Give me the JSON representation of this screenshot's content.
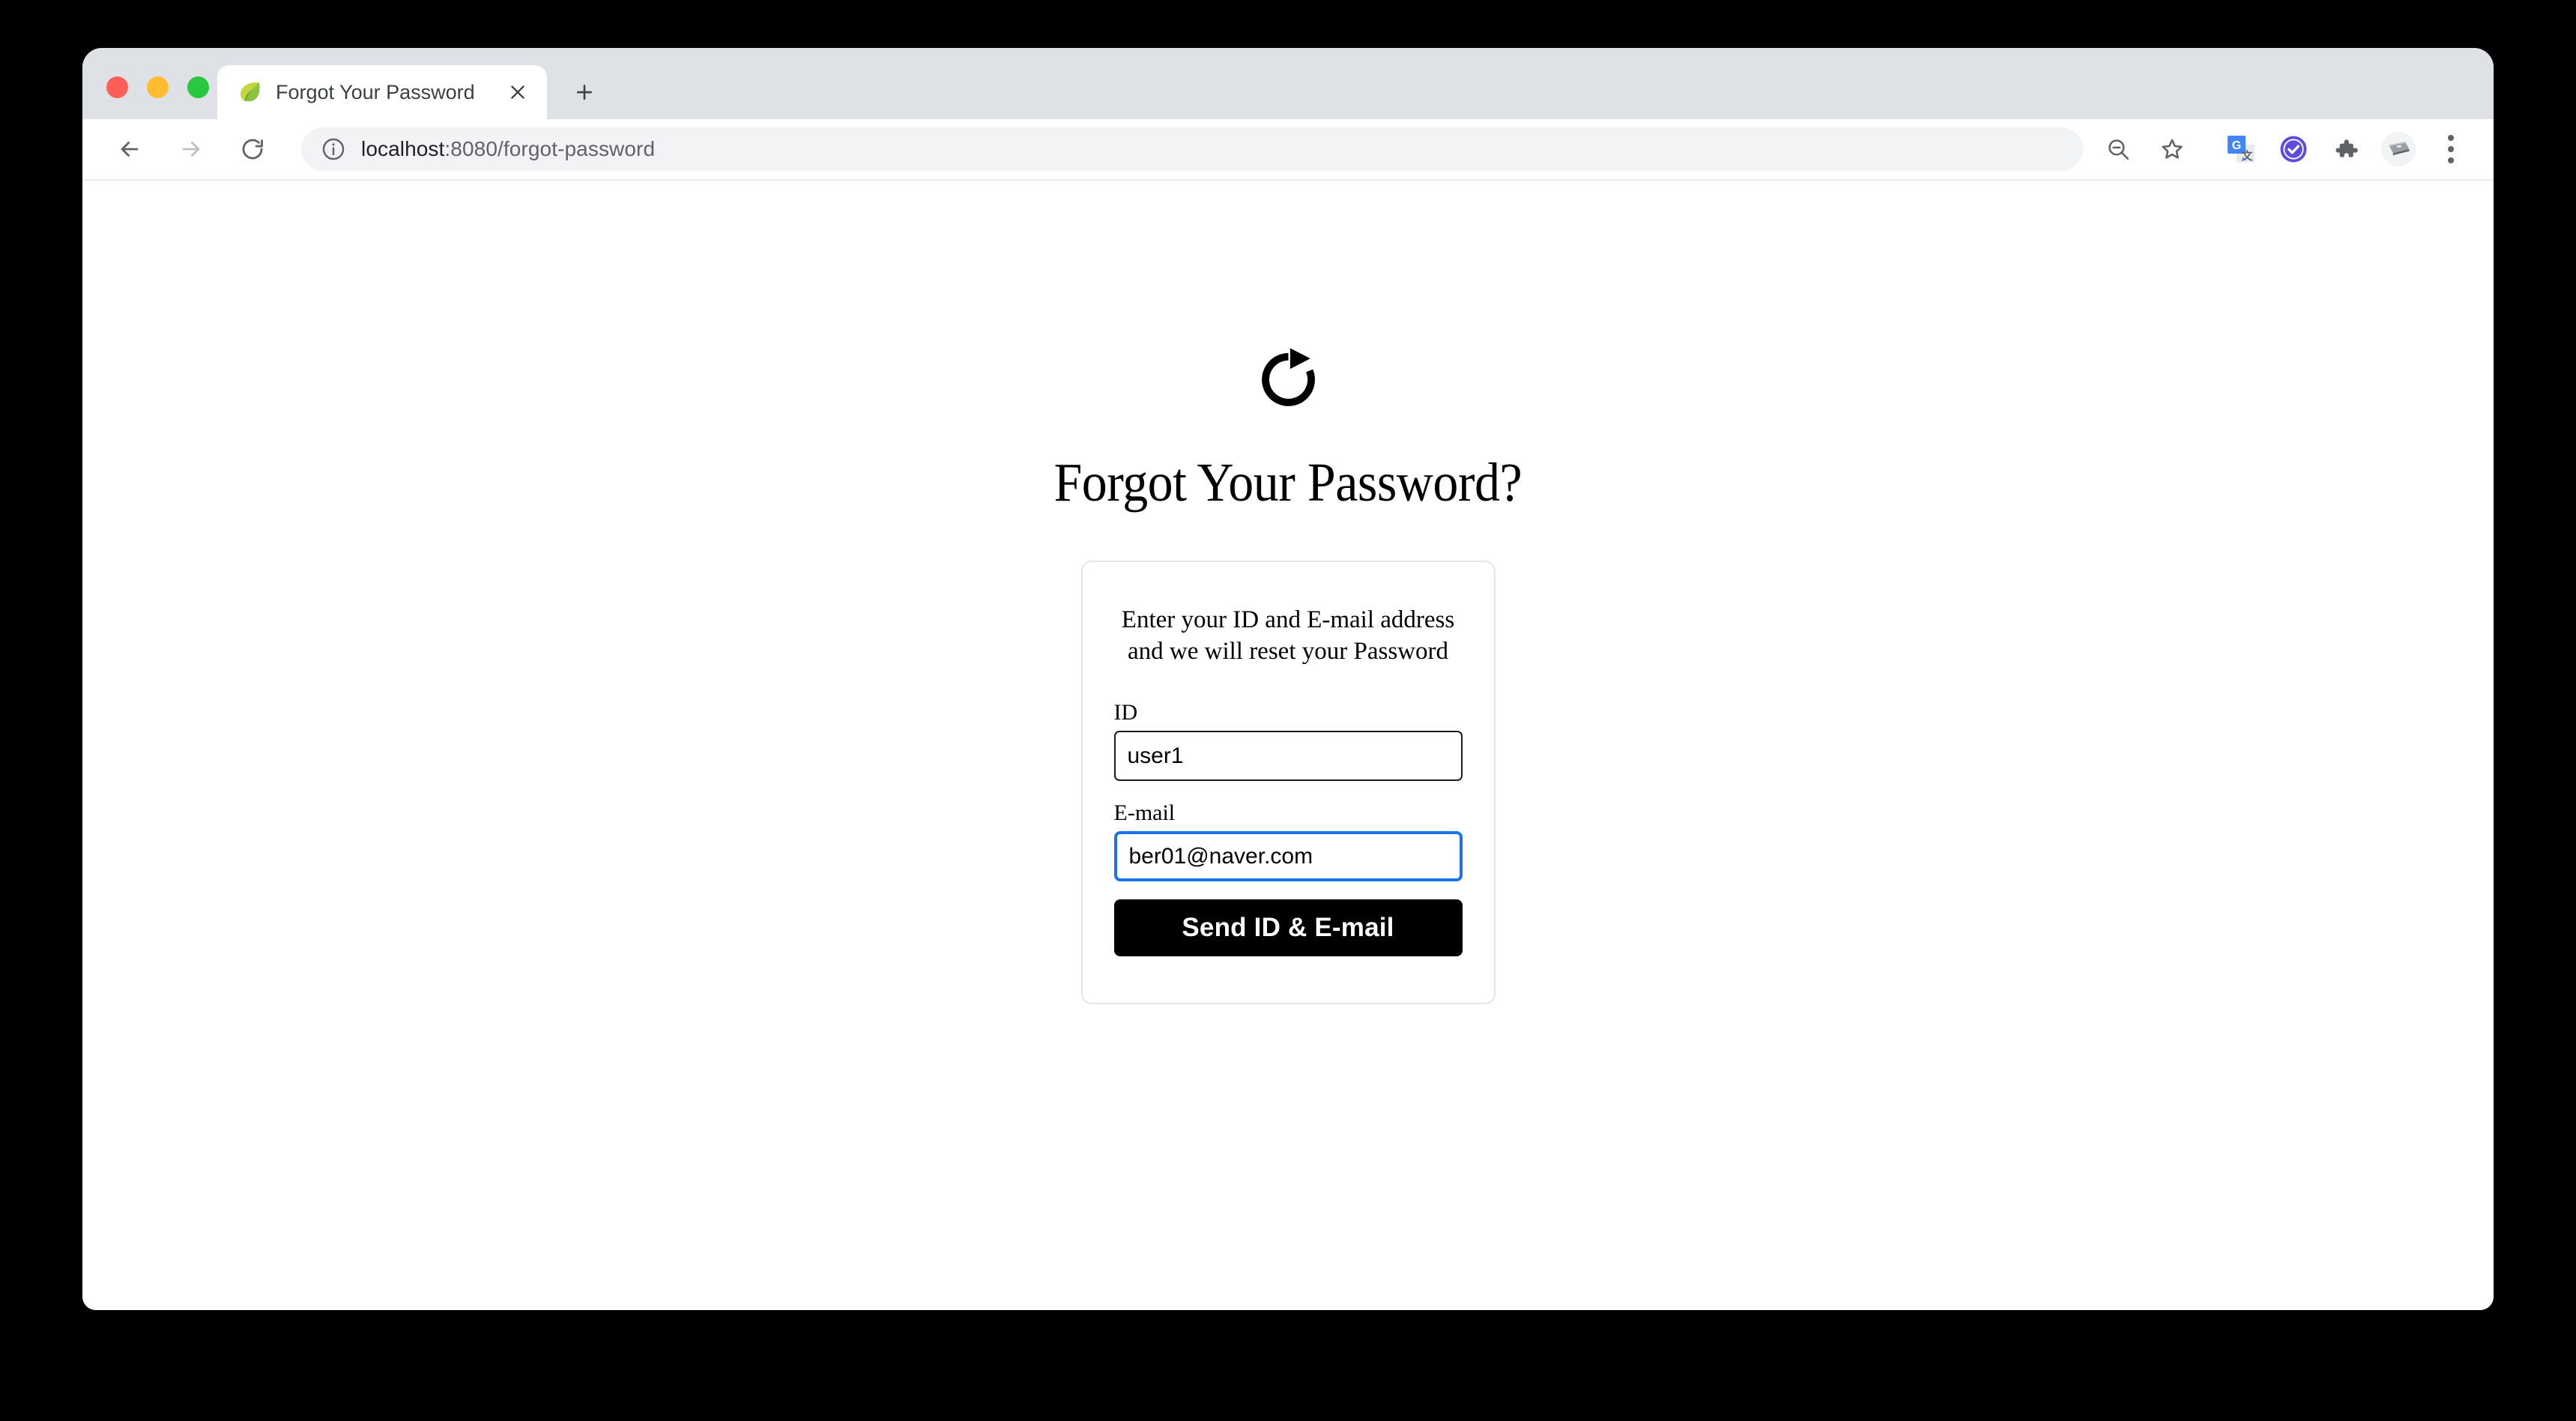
{
  "browser": {
    "traffic_lights": [
      {
        "name": "close",
        "color": "#ff5f57"
      },
      {
        "name": "minimize",
        "color": "#febc2e"
      },
      {
        "name": "zoom",
        "color": "#28c840"
      }
    ],
    "tab": {
      "title": "Forgot Your Password",
      "favicon": "spring-leaf-icon",
      "close_label": "×"
    },
    "new_tab_label": "+",
    "nav": {
      "back": "back-arrow-icon",
      "forward": "forward-arrow-icon",
      "reload": "reload-icon"
    },
    "omnibox": {
      "info_icon": "info-circle-icon",
      "host": "localhost",
      "path": ":8080/forgot-password",
      "full_url": "localhost:8080/forgot-password"
    },
    "toolbar_icons": [
      {
        "name": "zoom-out-icon"
      },
      {
        "name": "bookmark-star-icon"
      },
      {
        "name": "google-translate-icon"
      },
      {
        "name": "checkmark-badge-icon",
        "color": "#5b4cdb"
      },
      {
        "name": "extensions-puzzle-icon"
      },
      {
        "name": "profile-avatar-icon"
      },
      {
        "name": "chrome-menu-icon"
      }
    ]
  },
  "page": {
    "logo_icon": "refresh-rotate-icon",
    "title": "Forgot Your Password?",
    "card": {
      "subtitle_line1": "Enter your ID and E-mail address",
      "subtitle_line2": "and we will reset your Password",
      "fields": [
        {
          "label": "ID",
          "value": "user1",
          "placeholder": "",
          "focused": false
        },
        {
          "label": "E-mail",
          "value": "ber01@naver.com",
          "placeholder": "",
          "focused": true
        }
      ],
      "submit_label": "Send ID & E-mail"
    }
  },
  "colors": {
    "focus_ring": "#1a73e8",
    "button_bg": "#000000",
    "card_border": "#e3e6e9"
  }
}
